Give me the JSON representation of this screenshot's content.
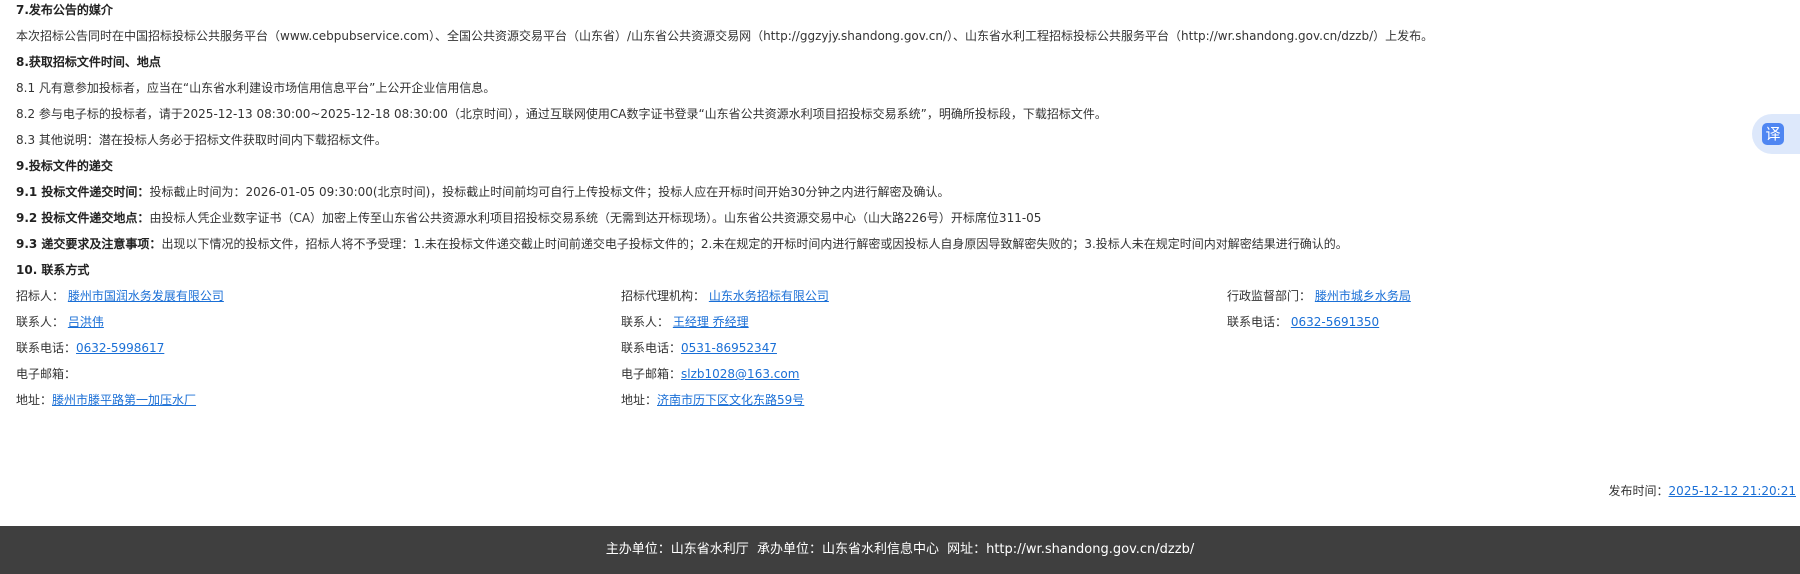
{
  "sections": {
    "s7_title": "7.发布公告的媒介",
    "s7_text": "本次招标公告同时在中国招标投标公共服务平台（www.cebpubservice.com）、全国公共资源交易平台（山东省）/山东省公共资源交易网（http://ggzyjy.shandong.gov.cn/）、山东省水利工程招标投标公共服务平台（http://wr.shandong.gov.cn/dzzb/）上发布。",
    "s8_title": "8.获取招标文件时间、地点",
    "s8_1": "8.1  凡有意参加投标者，应当在“山东省水利建设市场信用信息平台”上公开企业信用信息。",
    "s8_2": "8.2  参与电子标的投标者，请于2025-12-13 08:30:00~2025-12-18 08:30:00（北京时间），通过互联网使用CA数字证书登录“山东省公共资源水利项目招投标交易系统”，明确所投标段，下载招标文件。",
    "s8_3": "8.3  其他说明：潜在投标人务必于招标文件获取时间内下载招标文件。",
    "s9_title": "9.投标文件的递交",
    "s9_1_label": "9.1 投标文件递交时间：",
    "s9_1_text": "投标截止时间为：2026-01-05 09:30:00(北京时间)，投标截止时间前均可自行上传投标文件；投标人应在开标时间开始30分钟之内进行解密及确认。",
    "s9_2_label": "9.2 投标文件递交地点：",
    "s9_2_text": "由投标人凭企业数字证书（CA）加密上传至山东省公共资源水利项目招投标交易系统（无需到达开标现场）。山东省公共资源交易中心（山大路226号）开标席位311-05",
    "s9_3_label": "9.3 递交要求及注意事项：",
    "s9_3_text": "出现以下情况的投标文件，招标人将不予受理：1.未在投标文件递交截止时间前递交电子投标文件的；2.未在规定的开标时间内进行解密或因投标人自身原因导致解密失败的；3.投标人未在规定时间内对解密结果进行确认的。",
    "s10_title": "10. 联系方式"
  },
  "contacts": {
    "c1": {
      "owner_label": "招标人：",
      "owner": "滕州市国润水务发展有限公司",
      "person_label": "联系人：",
      "person": "吕洪伟",
      "phone_label": "联系电话：",
      "phone": "0632-5998617",
      "email_label": "电子邮箱：",
      "email": "",
      "address_label": "地址：",
      "address": "滕州市滕平路第一加压水厂"
    },
    "c2": {
      "owner_label": "招标代理机构：",
      "owner": "山东水务招标有限公司",
      "person_label": "联系人：",
      "person": "王经理 乔经理",
      "phone_label": "联系电话：",
      "phone": "0531-86952347",
      "email_label": "电子邮箱：",
      "email": "slzb1028@163.com",
      "address_label": "地址：",
      "address": "济南市历下区文化东路59号"
    },
    "c3": {
      "owner_label": "行政监督部门：",
      "owner": "滕州市城乡水务局",
      "phone_label": "联系电话：",
      "phone": "0632-5691350"
    }
  },
  "publish": {
    "label": "发布时间：",
    "time": "2025-12-12 21:20:21"
  },
  "translate_widget": {
    "icon": "translate-icon",
    "glyph": "译",
    "accent": "#4f86f2"
  },
  "footer": {
    "host": "主办单位：山东省水利厅",
    "undertaker": "承办单位：山东省水利信息中心",
    "website": "网址：http://wr.shandong.gov.cn/dzzb/"
  }
}
